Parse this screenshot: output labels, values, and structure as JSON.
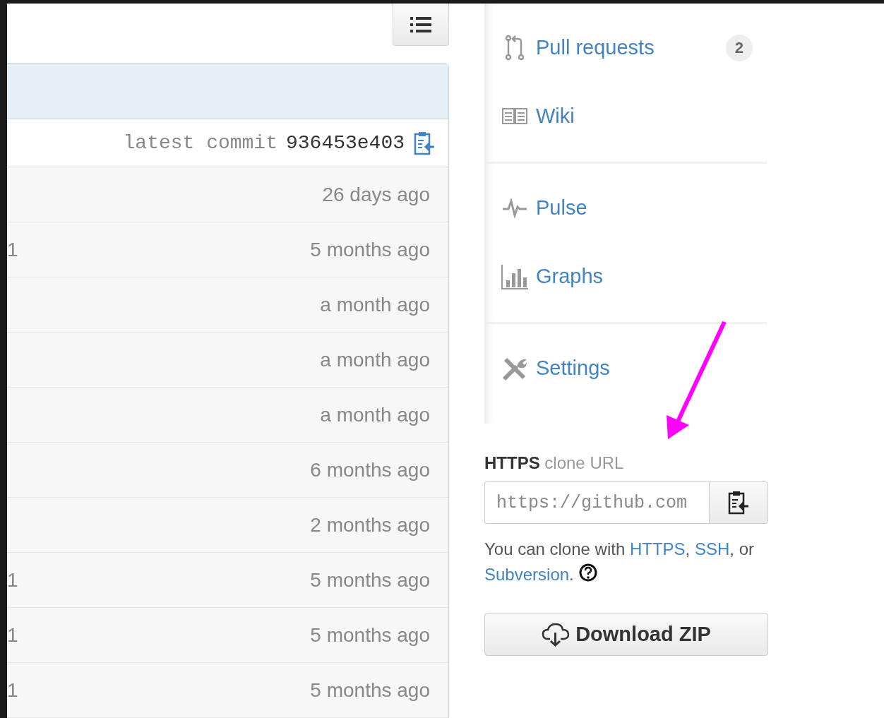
{
  "files": {
    "commit": {
      "label": "latest commit",
      "sha": "936453e403"
    },
    "rows": [
      {
        "age": "26 days ago"
      },
      {
        "column_1": "1",
        "age": "5 months ago"
      },
      {
        "age": "a month ago"
      },
      {
        "age": "a month ago"
      },
      {
        "age": "a month ago"
      },
      {
        "age": "6 months ago"
      },
      {
        "age": "2 months ago"
      },
      {
        "column_1": "1",
        "age": "5 months ago"
      },
      {
        "column_1": "1",
        "age": "5 months ago"
      },
      {
        "column_1": "1",
        "age": "5 months ago"
      }
    ]
  },
  "sidebar": {
    "groups": [
      [
        {
          "kind": "pull-request",
          "label": "Pull requests",
          "counter": "2"
        },
        {
          "kind": "book",
          "label": "Wiki"
        }
      ],
      [
        {
          "kind": "pulse",
          "label": "Pulse"
        },
        {
          "kind": "graph",
          "label": "Graphs"
        }
      ],
      [
        {
          "kind": "tools",
          "label": "Settings"
        }
      ]
    ]
  },
  "clone": {
    "protocol": "HTTPS",
    "label": "clone URL",
    "url": "https://github.com",
    "help": [
      {
        "kind": "text",
        "text": "You can clone with "
      },
      {
        "kind": "link",
        "text": "HTTPS"
      },
      {
        "kind": "text",
        "text": ", "
      },
      {
        "kind": "link",
        "text": "SSH"
      },
      {
        "kind": "text",
        "text": ", or "
      },
      {
        "kind": "link",
        "text": "Subversion"
      },
      {
        "kind": "text",
        "text": "."
      }
    ],
    "download": "Download ZIP"
  }
}
